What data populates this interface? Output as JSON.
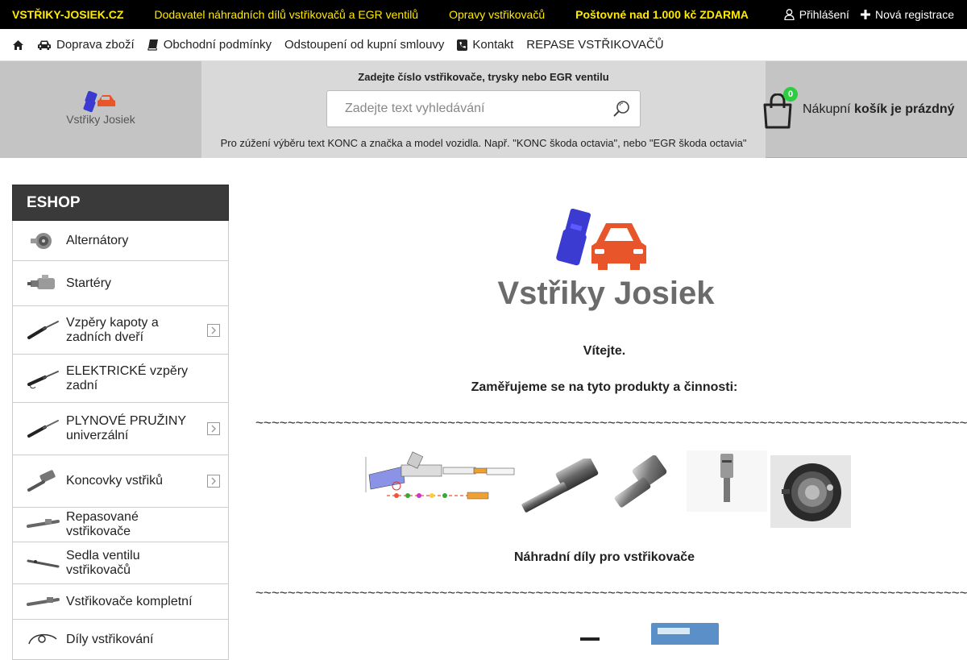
{
  "topbar": {
    "brand": "VSTŘIKY-JOSIEK.CZ",
    "tagline": "Dodavatel náhradních dílů vstřikovačů a EGR ventilů",
    "repairs": "Opravy vstřikovačů",
    "shipping": "Poštovné nad 1.000 kč ZDARMA",
    "login": "Přihlášení",
    "register": "Nová registrace"
  },
  "menu": {
    "items": [
      {
        "label": ""
      },
      {
        "label": "Doprava zboží"
      },
      {
        "label": "Obchodní podmínky"
      },
      {
        "label": "Odstoupení od kupní smlouvy"
      },
      {
        "label": "Kontakt"
      },
      {
        "label": "REPASE VSTŘIKOVAČŮ"
      }
    ]
  },
  "header": {
    "logo_text": "Vstřiky Josiek",
    "search_title": "Zadejte číslo vstřikovače, trysky nebo EGR ventilu",
    "search_placeholder": "Zadejte text vyhledávání",
    "search_hint": "Pro zúžení výběru text KONC a značka a model vozidla. Např. \"KONC škoda octavia\", nebo \"EGR škoda octavia\"",
    "cart_count": "0",
    "cart_prefix": "Nákupní",
    "cart_status": "košík je prázdný"
  },
  "sidebar": {
    "title": "ESHOP",
    "items": [
      {
        "label": "Alternátory",
        "has_sub": false
      },
      {
        "label": "Startéry",
        "has_sub": false
      },
      {
        "label": "Vzpěry kapoty a zadních dveří",
        "has_sub": true
      },
      {
        "label": "ELEKTRICKÉ vzpěry zadní",
        "has_sub": false
      },
      {
        "label": "PLYNOVÉ PRUŽINY univerzální",
        "has_sub": true
      },
      {
        "label": "Koncovky vstřiků",
        "has_sub": true
      },
      {
        "label": "Repasované vstřikovače",
        "has_sub": false
      },
      {
        "label": "Sedla ventilu vstřikovačů",
        "has_sub": false
      },
      {
        "label": "Vstřikovače kompletní",
        "has_sub": false
      },
      {
        "label": "Díly vstřikování",
        "has_sub": false
      }
    ]
  },
  "main": {
    "logo_text": "Vstřiky Josiek",
    "welcome": "Vítejte.",
    "focus": "Zaměřujeme se na tyto produkty a činnosti:",
    "separator": "~~~~~~~~~~~~~~~~~~~~~~~~~~~~~~~~~~~~~~~~~~~~~~~~~~~~~~~~~~~~~~~~~~~~~~~~~~~~~~~~~~~~~~~~~~~~",
    "parts_caption": "Náhradní díly pro vstřikovače"
  },
  "colors": {
    "topbar_bg": "#000000",
    "topbar_text": "#ffea00",
    "header_bg": "#c4c4c4",
    "sidebar_head": "#3a3a3a",
    "badge": "#2ecc40",
    "logo_blue": "#3b3bd1",
    "logo_orange": "#e8552b"
  }
}
